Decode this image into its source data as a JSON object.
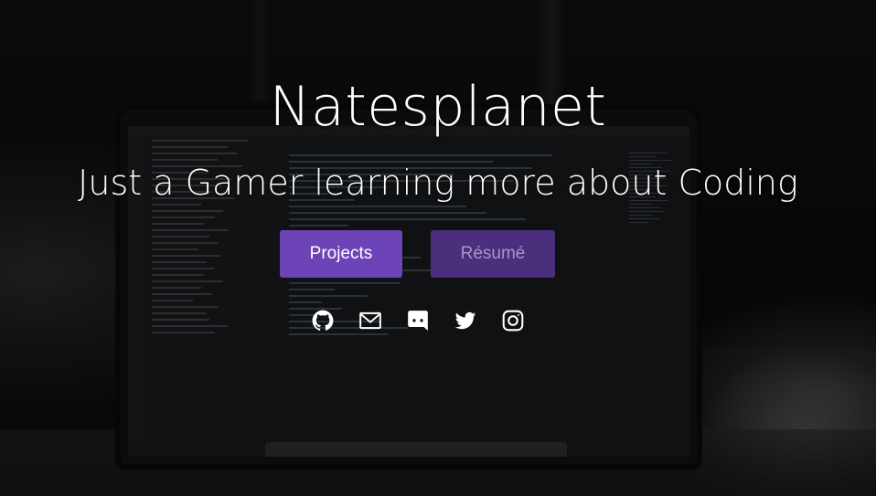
{
  "hero": {
    "title": "Natesplanet",
    "subtitle": "Just a Gamer learning more about Coding"
  },
  "buttons": {
    "projects_label": "Projects",
    "resume_label": "Résumé"
  },
  "socials": [
    {
      "icon": "github-icon"
    },
    {
      "icon": "mail-icon"
    },
    {
      "icon": "discord-icon"
    },
    {
      "icon": "twitter-icon"
    },
    {
      "icon": "instagram-icon"
    }
  ],
  "colors": {
    "projects_button": "#6d44b7",
    "resume_button": "#4b2f7d",
    "resume_text": "#a596c7",
    "text": "#ffffff"
  }
}
